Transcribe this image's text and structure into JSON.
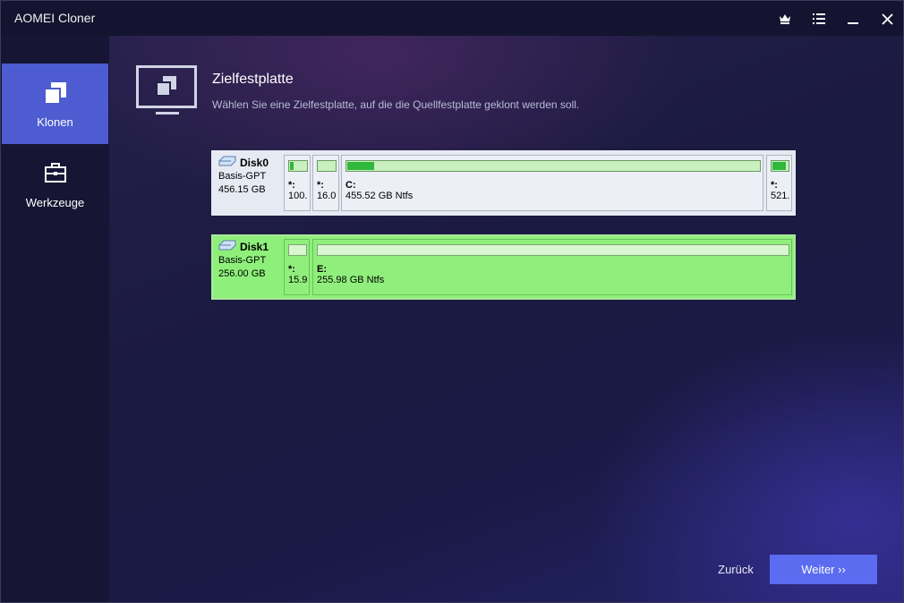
{
  "window": {
    "title": "AOMEI Cloner"
  },
  "titlebar": {
    "icons": [
      "crown-icon",
      "menu-list-icon",
      "minimize-icon",
      "close-icon"
    ]
  },
  "sidebar": {
    "items": [
      {
        "label": "Klonen",
        "icon": "clone-icon",
        "active": true
      },
      {
        "label": "Werkzeuge",
        "icon": "toolbox-icon",
        "active": false
      }
    ]
  },
  "header": {
    "title": "Zielfestplatte",
    "subtitle": "Wählen Sie eine Zielfestplatte, auf die die Quellfestplatte geklont werden soll."
  },
  "disks": [
    {
      "name": "Disk0",
      "type": "Basis-GPT",
      "size": "456.15 GB",
      "selected": false,
      "partitions": [
        {
          "label": "*:",
          "info": "100.",
          "used_fraction": 0.2
        },
        {
          "label": "*:",
          "info": "16.0",
          "used_fraction": 0.0
        },
        {
          "label": "C:",
          "info": "455.52 GB Ntfs",
          "used_fraction": 0.065
        },
        {
          "label": "*:",
          "info": "521.",
          "used_fraction": 0.8
        }
      ]
    },
    {
      "name": "Disk1",
      "type": "Basis-GPT",
      "size": "256.00 GB",
      "selected": true,
      "partitions": [
        {
          "label": "*:",
          "info": "15.9",
          "used_fraction": 0.0
        },
        {
          "label": "E:",
          "info": "255.98 GB Ntfs",
          "used_fraction": 0.0
        }
      ]
    }
  ],
  "footer": {
    "back_label": "Zurück",
    "next_label": "Weiter ››"
  },
  "colors": {
    "accent": "#5b6cf0",
    "sidebar_active": "#4d5cd0",
    "selected_disk": "#8ef07a",
    "used_bar": "#2fb83c"
  }
}
